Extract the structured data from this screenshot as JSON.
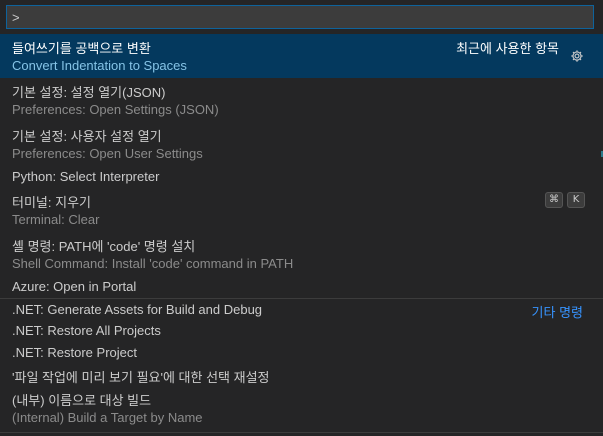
{
  "search": {
    "value": ">"
  },
  "items": [
    {
      "label": "들여쓰기를 공백으로 변환",
      "description": "Convert Indentation to Spaces",
      "meta": "최근에 사용한 항목",
      "icon": "gear-icon"
    },
    {
      "label": "기본 설정: 설정 열기(JSON)",
      "description": "Preferences: Open Settings (JSON)"
    },
    {
      "label": "기본 설정: 사용자 설정 열기",
      "description": "Preferences: Open User Settings"
    },
    {
      "label": "Python: Select Interpreter"
    },
    {
      "label": "터미널: 지우기",
      "description": "Terminal: Clear",
      "keybinding": [
        "⌘",
        "K"
      ]
    },
    {
      "label": "셸 명령: PATH에 'code' 명령 설치",
      "description": "Shell Command: Install 'code' command in PATH"
    },
    {
      "label": "Azure: Open in Portal"
    },
    {
      "label": ".NET: Generate Assets for Build and Debug",
      "group": "기타 명령"
    },
    {
      "label": ".NET: Restore All Projects"
    },
    {
      "label": ".NET: Restore Project"
    },
    {
      "label": "'파일 작업에 미리 보기 필요'에 대한 선택 재설정"
    },
    {
      "label": "(내부) 이름으로 대상 빌드",
      "description": "(Internal) Build a Target by Name"
    }
  ],
  "colors": {
    "background": "#252526",
    "selected": "#04395e",
    "accent": "#3794ff",
    "focus_border": "#0e639c"
  }
}
